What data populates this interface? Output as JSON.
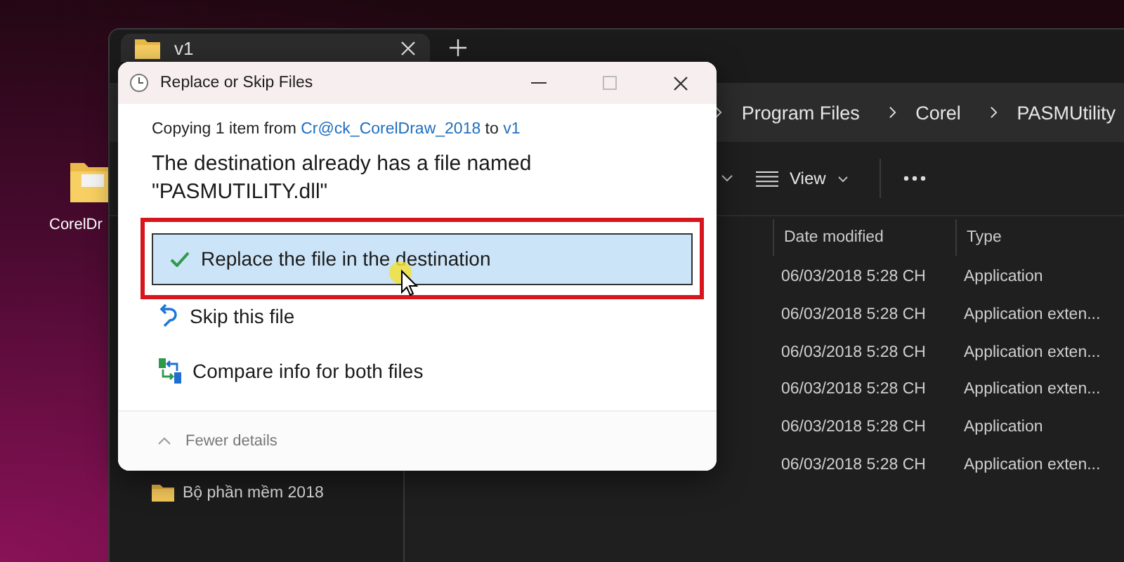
{
  "desktop": {
    "icons": [
      {
        "label": "CorelDr"
      }
    ]
  },
  "explorer": {
    "tabs": [
      {
        "title": "v1",
        "selected": true
      }
    ],
    "breadcrumb": [
      "Program Files",
      "Corel",
      "PASMUtility"
    ],
    "toolbar": {
      "view_label": "View"
    },
    "sidebar": {
      "items": [
        {
          "label": "Bộ phần mềm 2018"
        }
      ]
    },
    "table": {
      "columns": [
        "Date modified",
        "Type"
      ],
      "rows": [
        {
          "date": "06/03/2018 5:28 CH",
          "type": "Application"
        },
        {
          "date": "06/03/2018 5:28 CH",
          "type": "Application exten..."
        },
        {
          "date": "06/03/2018 5:28 CH",
          "type": "Application exten..."
        },
        {
          "date": "06/03/2018 5:28 CH",
          "type": "Application exten..."
        },
        {
          "date": "06/03/2018 5:28 CH",
          "type": "Application"
        },
        {
          "date": "06/03/2018 5:28 CH",
          "type": "Application exten..."
        }
      ]
    }
  },
  "dialog": {
    "title": "Replace or Skip Files",
    "copying": {
      "prefix": "Copying 1 item from",
      "source": "Cr@ck_CorelDraw_2018",
      "joiner": "to",
      "destination": "v1"
    },
    "message": "The destination already has a file named \"PASMUTILITY.dll\"",
    "options": [
      {
        "kind": "replace",
        "label": "Replace the file in the destination",
        "selected": true
      },
      {
        "kind": "skip",
        "label": "Skip this file",
        "selected": false
      },
      {
        "kind": "compare",
        "label": "Compare info for both files",
        "selected": false
      }
    ],
    "details_toggle": "Fewer details"
  }
}
